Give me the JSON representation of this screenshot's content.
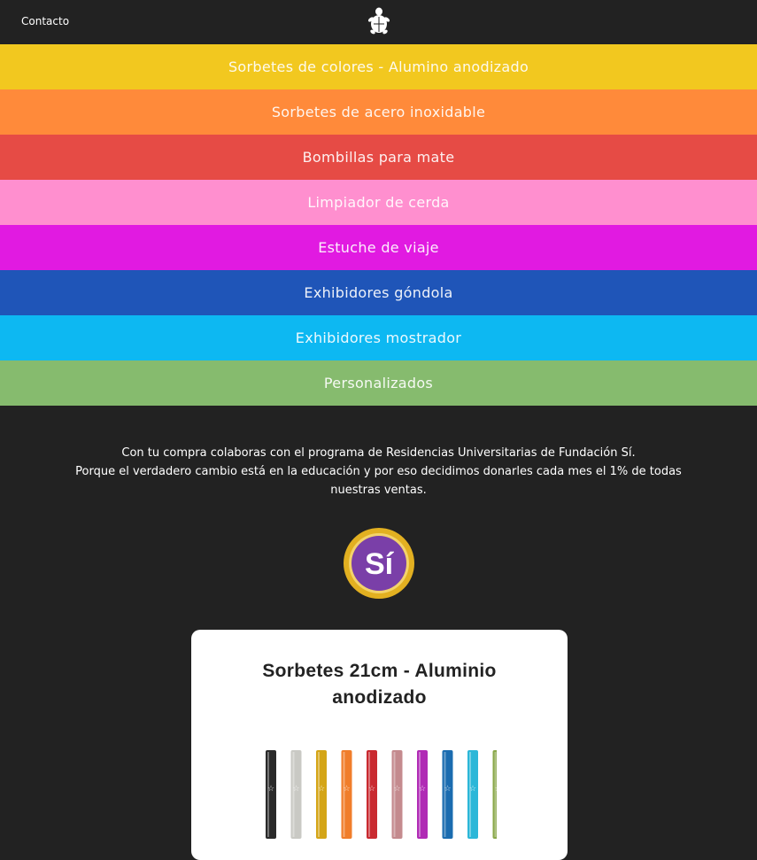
{
  "header": {
    "contact_label": "Contacto",
    "logo_icon": "turtle-icon"
  },
  "menu": {
    "items": [
      {
        "label": "Sorbetes de colores - Alumino anodizado",
        "color": "#f2c81f"
      },
      {
        "label": "Sorbetes de acero inoxidable",
        "color": "#ff8a3a"
      },
      {
        "label": "Bombillas para mate",
        "color": "#e64b45"
      },
      {
        "label": "Limpiador de cerda",
        "color": "#ff8fcf"
      },
      {
        "label": "Estuche de viaje",
        "color": "#e11ae1"
      },
      {
        "label": "Exhibidores góndola",
        "color": "#1f55b8"
      },
      {
        "label": "Exhibidores mostrador",
        "color": "#0db8f2"
      },
      {
        "label": "Personalizados",
        "color": "#86bb6e"
      }
    ]
  },
  "donation": {
    "line1": "Con tu compra colaboras con el programa de Residencias Universitarias de Fundación Sí.",
    "line2": "Porque el verdadero cambio está en la educación y por eso decidimos donarles cada mes el 1% de todas nuestras ventas.",
    "seal_text": "Sí",
    "seal_colors": {
      "ring": "#e2b021",
      "fill": "#7a3fa8"
    }
  },
  "product_card": {
    "title": "Sorbetes 21cm - Aluminio anodizado",
    "straw_colors": [
      "#2a2a2a",
      "#c9c9c4",
      "#d4a517",
      "#f07d2a",
      "#c92a30",
      "#c48a8e",
      "#b02bb5",
      "#1a6cb0",
      "#2cb7d8",
      "#8aa84a"
    ]
  }
}
